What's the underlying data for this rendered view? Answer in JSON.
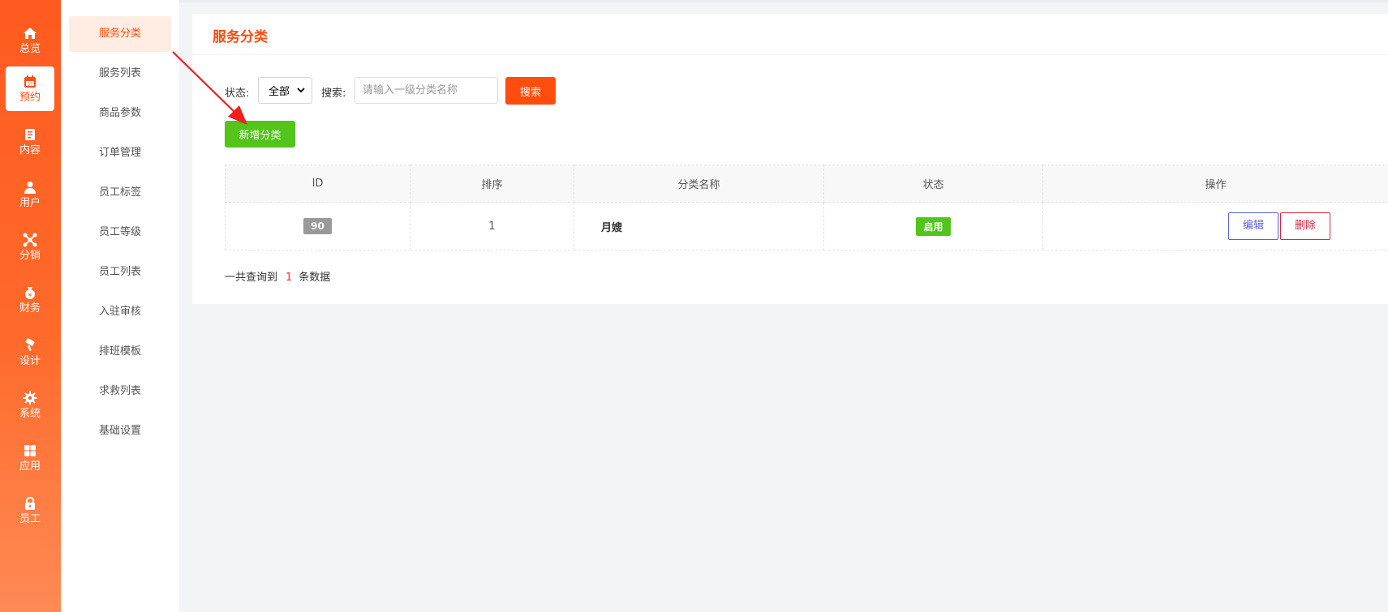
{
  "nav": {
    "items": [
      {
        "label": "总览",
        "icon": "home-icon",
        "active": false
      },
      {
        "label": "预约",
        "icon": "calendar-icon",
        "active": true
      },
      {
        "label": "内容",
        "icon": "document-icon",
        "active": false
      },
      {
        "label": "用户",
        "icon": "user-icon",
        "active": false
      },
      {
        "label": "分销",
        "icon": "share-icon",
        "active": false
      },
      {
        "label": "财务",
        "icon": "money-bag-icon",
        "active": false
      },
      {
        "label": "设计",
        "icon": "brush-icon",
        "active": false
      },
      {
        "label": "系统",
        "icon": "gear-icon",
        "active": false
      },
      {
        "label": "应用",
        "icon": "grid-icon",
        "active": false
      },
      {
        "label": "员工",
        "icon": "lock-icon",
        "active": false
      }
    ]
  },
  "submenu": {
    "items": [
      {
        "label": "服务分类",
        "active": true
      },
      {
        "label": "服务列表"
      },
      {
        "label": "商品参数"
      },
      {
        "label": "订单管理"
      },
      {
        "label": "员工标签"
      },
      {
        "label": "员工等级"
      },
      {
        "label": "员工列表"
      },
      {
        "label": "入驻审核"
      },
      {
        "label": "排班模板"
      },
      {
        "label": "求救列表"
      },
      {
        "label": "基础设置"
      }
    ]
  },
  "page": {
    "title": "服务分类"
  },
  "filter": {
    "status_label": "状态:",
    "status_value": "全部",
    "search_label": "搜索:",
    "search_placeholder": "请输入一级分类名称",
    "search_button": "搜索"
  },
  "add_button": "新增分类",
  "table": {
    "headers": [
      "ID",
      "排序",
      "分类名称",
      "状态",
      "操作"
    ],
    "rows": [
      {
        "id": "90",
        "sort": "1",
        "name": "月嫂",
        "status": "启用",
        "edit": "编辑",
        "delete": "删除"
      }
    ]
  },
  "summary": {
    "prefix": "一共查询到",
    "count": "1",
    "suffix": "条数据"
  },
  "colors": {
    "accent": "#ff4d0f",
    "success": "#52c41a",
    "edit": "#5b5fd6",
    "danger": "#d7263d"
  }
}
